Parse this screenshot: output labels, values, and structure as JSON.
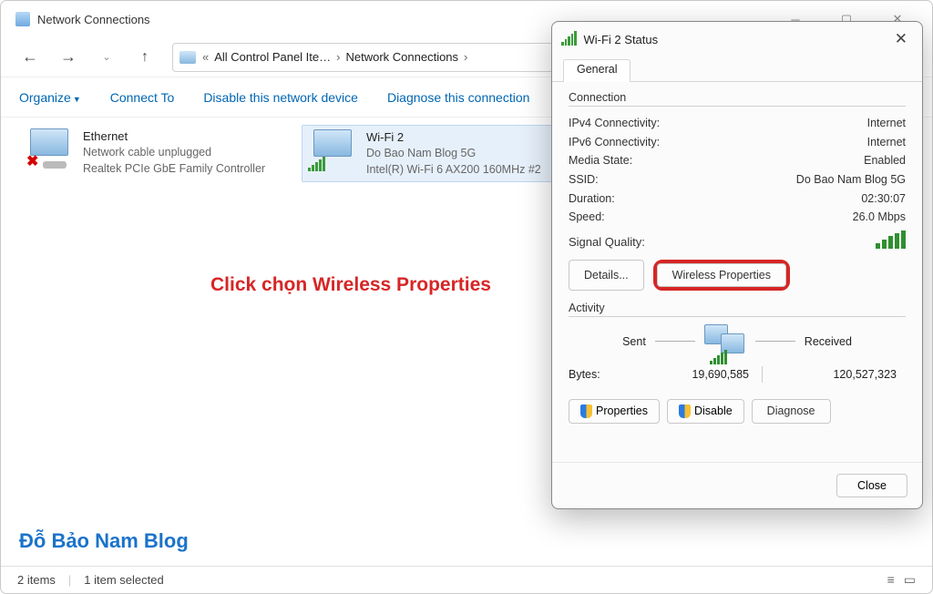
{
  "window": {
    "title": "Network Connections"
  },
  "breadcrumb": {
    "item1": "All Control Panel Ite…",
    "item2": "Network Connections"
  },
  "toolbar": {
    "organize": "Organize",
    "connect_to": "Connect To",
    "disable": "Disable this network device",
    "diagnose": "Diagnose this connection"
  },
  "adapters": [
    {
      "name": "Ethernet",
      "status": "Network cable unplugged",
      "device": "Realtek PCIe GbE Family Controller"
    },
    {
      "name": "Wi-Fi 2",
      "status": "Do Bao Nam Blog 5G",
      "device": "Intel(R) Wi-Fi 6 AX200 160MHz #2"
    }
  ],
  "annotation": {
    "prefix": "Click chọn ",
    "highlight": "Wireless Properties"
  },
  "watermark": "Đỗ Bảo Nam Blog",
  "statusbar": {
    "count": "2 items",
    "selected": "1 item selected"
  },
  "dialog": {
    "title": "Wi-Fi 2 Status",
    "tab_general": "General",
    "section_connection": "Connection",
    "ipv4_label": "IPv4 Connectivity:",
    "ipv4_value": "Internet",
    "ipv6_label": "IPv6 Connectivity:",
    "ipv6_value": "Internet",
    "media_label": "Media State:",
    "media_value": "Enabled",
    "ssid_label": "SSID:",
    "ssid_value": "Do Bao Nam Blog 5G",
    "duration_label": "Duration:",
    "duration_value": "02:30:07",
    "speed_label": "Speed:",
    "speed_value": "26.0 Mbps",
    "sigq_label": "Signal Quality:",
    "details_btn": "Details...",
    "wireless_props_btn": "Wireless Properties",
    "section_activity": "Activity",
    "sent_label": "Sent",
    "received_label": "Received",
    "bytes_label": "Bytes:",
    "bytes_sent": "19,690,585",
    "bytes_recv": "120,527,323",
    "properties_btn": "Properties",
    "disable_btn": "Disable",
    "diagnose_btn": "Diagnose",
    "close_btn": "Close"
  }
}
